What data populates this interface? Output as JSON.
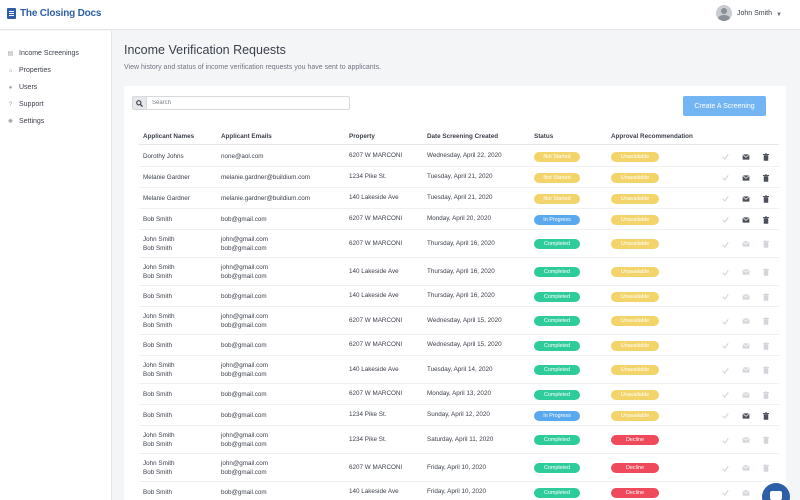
{
  "app": {
    "logo_text": "The Closing Docs"
  },
  "user": {
    "name": "John Smith"
  },
  "sidebar": {
    "items": [
      {
        "label": "Income Screenings",
        "icon": "document-icon"
      },
      {
        "label": "Properties",
        "icon": "home-icon"
      },
      {
        "label": "Users",
        "icon": "user-icon"
      },
      {
        "label": "Support",
        "icon": "help-icon"
      },
      {
        "label": "Settings",
        "icon": "gear-icon"
      }
    ]
  },
  "page": {
    "title": "Income Verification Requests",
    "subtitle": "View history and status of income verification requests you have sent to applicants."
  },
  "search": {
    "placeholder": "Search"
  },
  "toolbar": {
    "create_label": "Create A Screening"
  },
  "table": {
    "headers": [
      "Applicant Names",
      "Applicant Emails",
      "Property",
      "Date Screening Created",
      "Status",
      "Approval Recommendation"
    ],
    "rows": [
      {
        "names": [
          "Dorothy Johns"
        ],
        "emails": [
          "none@aol.com"
        ],
        "property": "6207 W MARCONI",
        "date": "Wednesday, April 22, 2020",
        "status": "Not Started",
        "approval": "Unavailable",
        "actions_active": true
      },
      {
        "names": [
          "Melanie Gardner"
        ],
        "emails": [
          "melanie.gardner@buildium.com"
        ],
        "property": "1234 Pike St.",
        "date": "Tuesday, April 21, 2020",
        "status": "Not Started",
        "approval": "Unavailable",
        "actions_active": true
      },
      {
        "names": [
          "Melanie Gardner"
        ],
        "emails": [
          "melanie.gardner@buildium.com"
        ],
        "property": "140 Lakeside Ave",
        "date": "Tuesday, April 21, 2020",
        "status": "Not Started",
        "approval": "Unavailable",
        "actions_active": true
      },
      {
        "names": [
          "Bob Smith"
        ],
        "emails": [
          "bob@gmail.com"
        ],
        "property": "6207 W MARCONI",
        "date": "Monday, April 20, 2020",
        "status": "In Progress",
        "approval": "Unavailable",
        "actions_active": true
      },
      {
        "names": [
          "John Smith",
          "Bob Smith"
        ],
        "emails": [
          "john@gmail.com",
          "bob@gmail.com"
        ],
        "property": "6207 W MARCONI",
        "date": "Thursday, April 16, 2020",
        "status": "Completed",
        "approval": "Unavailable",
        "actions_active": false
      },
      {
        "names": [
          "John Smith",
          "Bob Smith"
        ],
        "emails": [
          "john@gmail.com",
          "bob@gmail.com"
        ],
        "property": "140 Lakeside Ave",
        "date": "Thursday, April 16, 2020",
        "status": "Completed",
        "approval": "Unavailable",
        "actions_active": false
      },
      {
        "names": [
          "Bob Smith"
        ],
        "emails": [
          "bob@gmail.com"
        ],
        "property": "140 Lakeside Ave",
        "date": "Thursday, April 16, 2020",
        "status": "Completed",
        "approval": "Unavailable",
        "actions_active": false
      },
      {
        "names": [
          "John Smith",
          "Bob Smith"
        ],
        "emails": [
          "john@gmail.com",
          "bob@gmail.com"
        ],
        "property": "6207 W MARCONI",
        "date": "Wednesday, April 15, 2020",
        "status": "Completed",
        "approval": "Unavailable",
        "actions_active": false
      },
      {
        "names": [
          "Bob Smith"
        ],
        "emails": [
          "bob@gmail.com"
        ],
        "property": "6207 W MARCONI",
        "date": "Wednesday, April 15, 2020",
        "status": "Completed",
        "approval": "Unavailable",
        "actions_active": false
      },
      {
        "names": [
          "John Smith",
          "Bob Smith"
        ],
        "emails": [
          "john@gmail.com",
          "bob@gmail.com"
        ],
        "property": "140 Lakeside Ave",
        "date": "Tuesday, April 14, 2020",
        "status": "Completed",
        "approval": "Unavailable",
        "actions_active": false
      },
      {
        "names": [
          "Bob Smith"
        ],
        "emails": [
          "bob@gmail.com"
        ],
        "property": "6207 W MARCONI",
        "date": "Monday, April 13, 2020",
        "status": "Completed",
        "approval": "Unavailable",
        "actions_active": false
      },
      {
        "names": [
          "Bob Smith"
        ],
        "emails": [
          "bob@gmail.com"
        ],
        "property": "1234 Pike St.",
        "date": "Sunday, April 12, 2020",
        "status": "In Progress",
        "approval": "Unavailable",
        "actions_active": true
      },
      {
        "names": [
          "John Smith",
          "Bob Smith"
        ],
        "emails": [
          "john@gmail.com",
          "bob@gmail.com"
        ],
        "property": "1234 Pike St.",
        "date": "Saturday, April 11, 2020",
        "status": "Completed",
        "approval": "Decline",
        "actions_active": false
      },
      {
        "names": [
          "John Smith",
          "Bob Smith"
        ],
        "emails": [
          "john@gmail.com",
          "bob@gmail.com"
        ],
        "property": "6207 W MARCONI",
        "date": "Friday, April 10, 2020",
        "status": "Completed",
        "approval": "Decline",
        "actions_active": false
      },
      {
        "names": [
          "Bob Smith"
        ],
        "emails": [
          "bob@gmail.com"
        ],
        "property": "140 Lakeside Ave",
        "date": "Friday, April 10, 2020",
        "status": "Completed",
        "approval": "Decline",
        "actions_active": false
      }
    ]
  },
  "colors": {
    "brand": "#2d5fa8",
    "not_started": "#f2d46b",
    "in_progress": "#5aa9ee",
    "completed": "#2ecc9a",
    "unavailable": "#f2d46b",
    "decline": "#ef4a5c",
    "action_active": "#4a4f58",
    "action_inactive": "#d2d5da"
  }
}
